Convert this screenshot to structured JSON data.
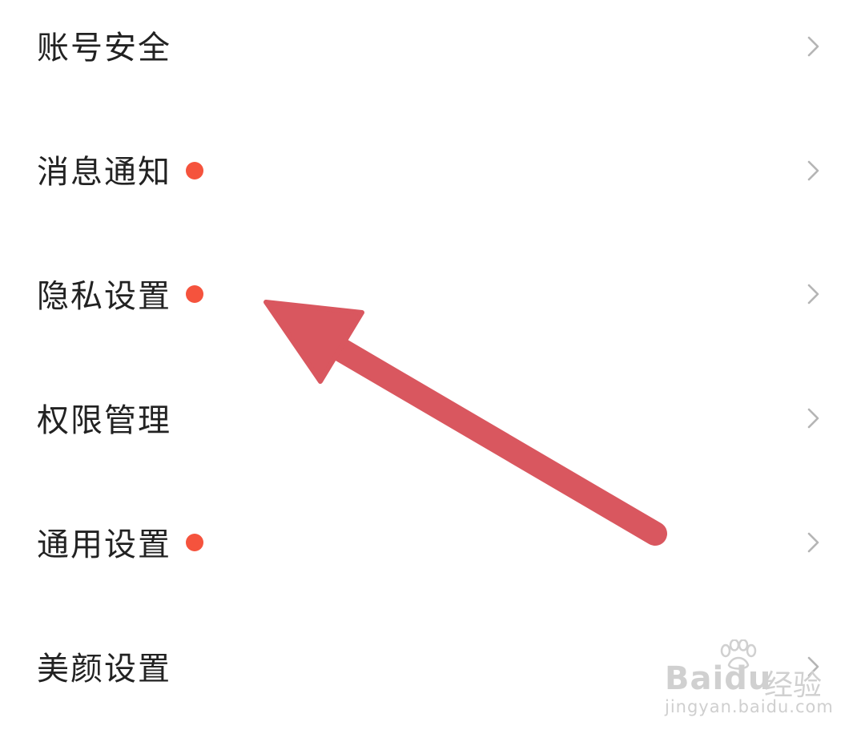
{
  "menu": {
    "items": [
      {
        "label": "账号安全",
        "has_dot": false,
        "chevron": "chevron-right-icon"
      },
      {
        "label": "消息通知",
        "has_dot": true,
        "chevron": "chevron-right-icon"
      },
      {
        "label": "隐私设置",
        "has_dot": true,
        "chevron": "chevron-right-icon"
      },
      {
        "label": "权限管理",
        "has_dot": false,
        "chevron": "chevron-right-icon"
      },
      {
        "label": "通用设置",
        "has_dot": true,
        "chevron": "chevron-right-icon"
      },
      {
        "label": "美颜设置",
        "has_dot": false,
        "chevron": "chevron-right-icon"
      }
    ]
  },
  "annotation": {
    "icon": "arrow-icon",
    "color": "#d9575f"
  },
  "watermark": {
    "brand": "Baidu",
    "brand_cn": "经验",
    "url": "jingyan.baidu.com"
  },
  "colors": {
    "dot": "#f5533d",
    "text": "#222222",
    "chevron": "#b5b5b5",
    "background": "#ffffff"
  }
}
